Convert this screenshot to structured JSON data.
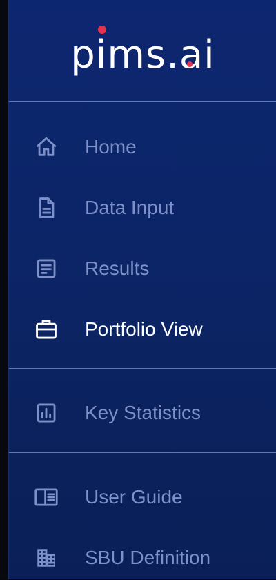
{
  "brand": {
    "logo_text": "pims.ai",
    "accent_color": "#e5334d"
  },
  "colors": {
    "sidebar_bg": "#0c2566",
    "inactive_text": "#7d90c8",
    "active_text": "#ffffff"
  },
  "nav": {
    "primary": [
      {
        "label": "Home",
        "icon": "home-icon",
        "active": false
      },
      {
        "label": "Data Input",
        "icon": "document-icon",
        "active": false
      },
      {
        "label": "Results",
        "icon": "results-icon",
        "active": false
      },
      {
        "label": "Portfolio View",
        "icon": "briefcase-icon",
        "active": true
      }
    ],
    "secondary": [
      {
        "label": "Key Statistics",
        "icon": "bar-chart-icon",
        "active": false
      }
    ],
    "tertiary": [
      {
        "label": "User Guide",
        "icon": "book-icon",
        "active": false
      },
      {
        "label": "SBU Definition",
        "icon": "building-icon",
        "active": false
      }
    ]
  }
}
